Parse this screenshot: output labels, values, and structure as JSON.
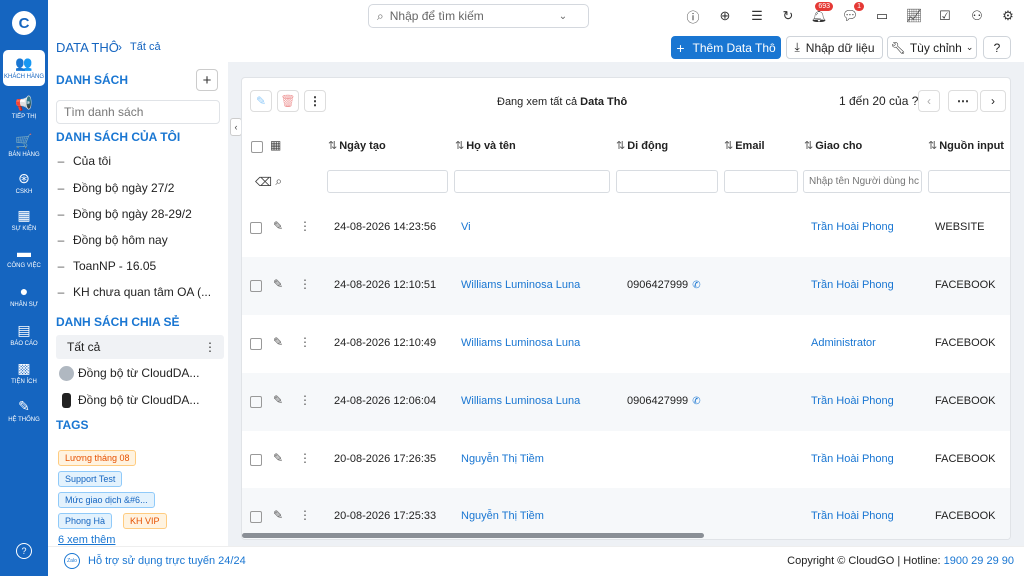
{
  "rail": {
    "logo": "C",
    "items": [
      {
        "label": "Khách hàng",
        "icon": "users-icon",
        "glyph": "👥"
      },
      {
        "label": "Tiếp thị",
        "icon": "megaphone-icon",
        "glyph": "📢"
      },
      {
        "label": "Bán hàng",
        "icon": "cart-icon",
        "glyph": "🛒"
      },
      {
        "label": "CSKH",
        "icon": "lifebuoy-icon",
        "glyph": "⊛"
      },
      {
        "label": "Sự kiện",
        "icon": "calendar-icon",
        "glyph": "▦"
      },
      {
        "label": "Công việc",
        "icon": "briefcase-icon",
        "glyph": "▬"
      },
      {
        "label": "Nhân sự",
        "icon": "person-icon",
        "glyph": "●"
      },
      {
        "label": "Báo cáo",
        "icon": "report-icon",
        "glyph": "▤"
      },
      {
        "label": "Tiện ích",
        "icon": "puzzle-icon",
        "glyph": "▩"
      },
      {
        "label": "Hệ thống",
        "icon": "wrench-icon",
        "glyph": "✎"
      }
    ],
    "help_glyph": "?"
  },
  "topbar": {
    "search_placeholder": "Nhập để tìm kiếm",
    "badge_notifications": "693",
    "badge_messages": "1"
  },
  "header": {
    "crumb_root": "DATA THÔ",
    "crumb_current": "Tất cả",
    "add_button": "Thêm Data Thô",
    "import_button": "Nhập dữ liệu",
    "customize_button": "Tùy chỉnh"
  },
  "lists": {
    "title": "DANH SÁCH",
    "search_placeholder": "Tìm danh sách",
    "my_lists_title": "DANH SÁCH CỦA TÔI",
    "my_lists": [
      "Của tôi",
      "Đồng bộ ngày 27/2",
      "Đồng bộ ngày 28-29/2",
      "Đồng bộ hôm nay",
      "ToanNP - 16.05",
      "KH chưa quan tâm OA (..."
    ],
    "shared_title": "DANH SÁCH CHIA SẺ",
    "shared_lists": [
      "Tất cả",
      "Đồng bộ từ CloudDA...",
      "Đồng bộ từ CloudDA..."
    ],
    "tags_title": "TAGS",
    "tags": [
      "Lương tháng 08",
      "Support Test",
      "Mức giao dịch &#6...",
      "Phong Hà",
      "KH VIP"
    ],
    "more_tags": "6 xem thêm"
  },
  "grid": {
    "view_prefix": "Đang xem tất cả",
    "view_name": "Data Thô",
    "page_info": "1 đến 20 của ?",
    "columns": [
      "Ngày tạo",
      "Họ và tên",
      "Di động",
      "Email",
      "Giao cho",
      "Nguồn input"
    ],
    "assignee_filter_placeholder": "Nhập tên Người dùng hc",
    "rows": [
      {
        "date": "24-08-2026 14:23:56",
        "name": "Vi",
        "phone": "",
        "email": "",
        "assignee": "Trần Hoài Phong",
        "source": "WEBSITE"
      },
      {
        "date": "24-08-2026 12:10:51",
        "name": "Williams Luminosa Luna",
        "phone": "0906427999",
        "email": "",
        "assignee": "Trần Hoài Phong",
        "source": "FACEBOOK"
      },
      {
        "date": "24-08-2026 12:10:49",
        "name": "Williams Luminosa Luna",
        "phone": "",
        "email": "",
        "assignee": "Administrator",
        "source": "FACEBOOK"
      },
      {
        "date": "24-08-2026 12:06:04",
        "name": "Williams Luminosa Luna",
        "phone": "0906427999",
        "email": "",
        "assignee": "Trần Hoài Phong",
        "source": "FACEBOOK"
      },
      {
        "date": "20-08-2026 17:26:35",
        "name": "Nguyễn Thị Tiềm",
        "phone": "",
        "email": "",
        "assignee": "Trần Hoài Phong",
        "source": "FACEBOOK"
      },
      {
        "date": "20-08-2026 17:25:33",
        "name": "Nguyễn Thị Tiềm",
        "phone": "",
        "email": "",
        "assignee": "Trần Hoài Phong",
        "source": "FACEBOOK"
      }
    ]
  },
  "footer": {
    "zalo": "Zalo",
    "support": "Hỗ trợ sử dụng trực tuyến 24/24",
    "copyright": "Copyright © CloudGO",
    "hotline_label": "| Hotline:",
    "hotline": "1900 29 29 90"
  }
}
